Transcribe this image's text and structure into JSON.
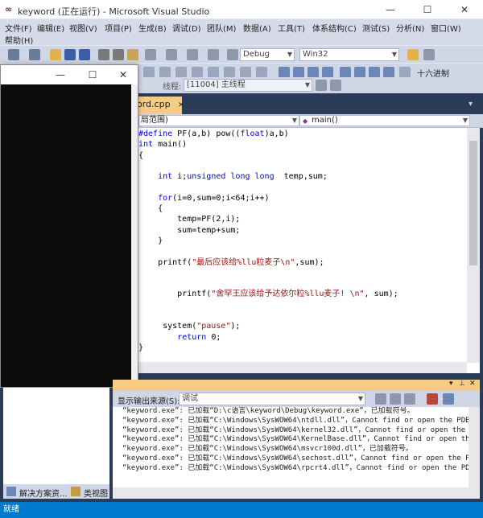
{
  "window": {
    "title": "keyword (正在运行) - Microsoft Visual Studio",
    "logo_glyph": "∞",
    "min": "—",
    "max": "☐",
    "close": "✕"
  },
  "menu": [
    "文件(F)",
    "编辑(E)",
    "视图(V)",
    "项目(P)",
    "生成(B)",
    "调试(D)",
    "团队(M)",
    "数据(A)",
    "工具(T)",
    "体系结构(C)",
    "测试(S)",
    "分析(N)",
    "窗口(W)",
    "帮助(H)"
  ],
  "toolbar": {
    "config": "Debug",
    "platform": "Win32",
    "hex_label": "十六进制",
    "thread_label": "线程:",
    "thread_value": "[11004] 主线程"
  },
  "editor": {
    "tab_label": "ord.cpp",
    "nav_scope": "局范围)",
    "nav_func": "main()",
    "lines": [
      {
        "parts": [
          {
            "t": "#define",
            "c": "kw"
          },
          {
            "t": " PF(a,b) pow(("
          },
          {
            "t": "float",
            "c": "kw"
          },
          {
            "t": ")a,b)"
          }
        ]
      },
      {
        "parts": [
          {
            "t": "int",
            "c": "kw"
          },
          {
            "t": " main()"
          }
        ]
      },
      {
        "parts": [
          {
            "t": "{"
          }
        ]
      },
      {
        "parts": [
          {
            "t": ""
          }
        ]
      },
      {
        "parts": [
          {
            "t": "    "
          },
          {
            "t": "int",
            "c": "kw"
          },
          {
            "t": " i;"
          },
          {
            "t": "unsigned long long",
            "c": "kw"
          },
          {
            "t": "  temp,sum;"
          }
        ]
      },
      {
        "parts": [
          {
            "t": ""
          }
        ]
      },
      {
        "parts": [
          {
            "t": "    "
          },
          {
            "t": "for",
            "c": "kw"
          },
          {
            "t": "(i=0,sum=0;i<64;i++)"
          }
        ]
      },
      {
        "parts": [
          {
            "t": "    {"
          }
        ]
      },
      {
        "parts": [
          {
            "t": "        temp=PF(2,i);"
          }
        ]
      },
      {
        "parts": [
          {
            "t": "        sum=temp+sum;"
          }
        ]
      },
      {
        "parts": [
          {
            "t": "    }"
          }
        ]
      },
      {
        "parts": [
          {
            "t": ""
          }
        ]
      },
      {
        "parts": [
          {
            "t": "    printf("
          },
          {
            "t": "\"最后应该给%llu粒麦子\\n\"",
            "c": "str"
          },
          {
            "t": ",sum);"
          }
        ]
      },
      {
        "parts": [
          {
            "t": ""
          }
        ]
      },
      {
        "parts": [
          {
            "t": ""
          }
        ]
      },
      {
        "parts": [
          {
            "t": "        printf("
          },
          {
            "t": "\"舍罕王应该给予达依尔粒%llu麦子! \\n\"",
            "c": "str"
          },
          {
            "t": ", sum);"
          }
        ]
      },
      {
        "parts": [
          {
            "t": ""
          }
        ]
      },
      {
        "parts": [
          {
            "t": ""
          }
        ]
      },
      {
        "parts": [
          {
            "t": "     system("
          },
          {
            "t": "\"pause\"",
            "c": "str"
          },
          {
            "t": ");"
          }
        ]
      },
      {
        "parts": [
          {
            "t": "        "
          },
          {
            "t": "return",
            "c": "kw"
          },
          {
            "t": " 0;"
          }
        ]
      },
      {
        "parts": [
          {
            "t": "}"
          }
        ]
      }
    ]
  },
  "console": {
    "min": "—",
    "max": "☐",
    "close": "✕"
  },
  "solution_tabs": [
    "解决方案资...",
    "类视图"
  ],
  "output": {
    "source_label": "显示输出来源(S):",
    "source_value": "调试",
    "lines": [
      "“keyword.exe”: 已加载“D:\\c语言\\keyword\\Debug\\keyword.exe”，已加载符号。",
      "“keyword.exe”: 已加载“C:\\Windows\\SysWOW64\\ntdll.dll”，Cannot find or open the PDB",
      "“keyword.exe”: 已加载“C:\\Windows\\SysWOW64\\kernel32.dll”，Cannot find or open the PI",
      "“keyword.exe”: 已加载“C:\\Windows\\SysWOW64\\KernelBase.dll”，Cannot find or open the",
      "“keyword.exe”: 已加载“C:\\Windows\\SysWOW64\\msvcr100d.dll”，已加载符号。",
      "“keyword.exe”: 已加载“C:\\Windows\\SysWOW64\\sechost.dll”，Cannot find or open the PDB",
      "“keyword.exe”: 已加载“C:\\Windows\\SysWOW64\\rpcrt4.dll”，Cannot find or open the PDB"
    ]
  },
  "status": "就绪"
}
